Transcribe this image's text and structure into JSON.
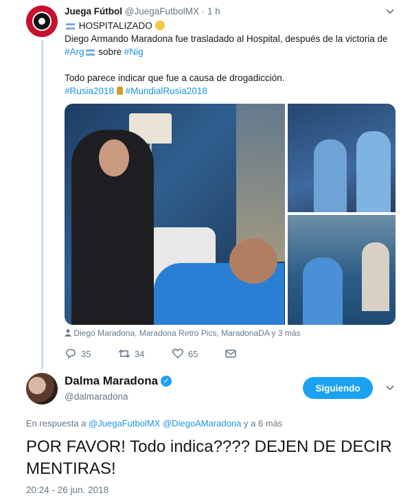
{
  "quoted_tweet": {
    "author_name": "Juega Fútbol",
    "author_handle": "@JuegaFutbolMX",
    "time": "· 1 h",
    "line1": "HOSPITALIZADO",
    "line2": "Diego Armando Maradona fue trasladado al Hospital, después de la victoria de",
    "line3_hash1": "#Arg",
    "line3_mid": "sobre",
    "line3_hash2": "#Nig",
    "line4": "Todo parece indicar que fue a causa de drogadicción.",
    "hashtag1": "#Rusia2018",
    "hashtag2": "#MundialRusia2018",
    "photo_credit": "Diego Maradona, Maradona Retro Pics, MaradonaDA y 3 más",
    "replies": "35",
    "retweets": "34",
    "likes": "65"
  },
  "main_tweet": {
    "author_name": "Dalma Maradona",
    "author_handle": "@dalmaradona",
    "follow_label": "Siguiendo",
    "reply_prefix": "En respuesta a",
    "reply_handle1": "@JuegaFutbolMX",
    "reply_handle2": "@DiegoAMaradona",
    "reply_suffix": "y a 6 más",
    "text": "POR FAVOR! Todo indica???? DEJEN DE DECIR MENTIRAS!",
    "timestamp": "20:24 - 26 jun. 2018"
  },
  "icons": [
    "reply-icon",
    "retweet-icon",
    "like-icon",
    "message-icon",
    "chevron-down-icon",
    "verified-icon",
    "person-icon"
  ],
  "colors": {
    "accent": "#1da1f2",
    "hashtag": "#1b95e0",
    "muted": "#657786",
    "thread": "#c4e0f2"
  }
}
